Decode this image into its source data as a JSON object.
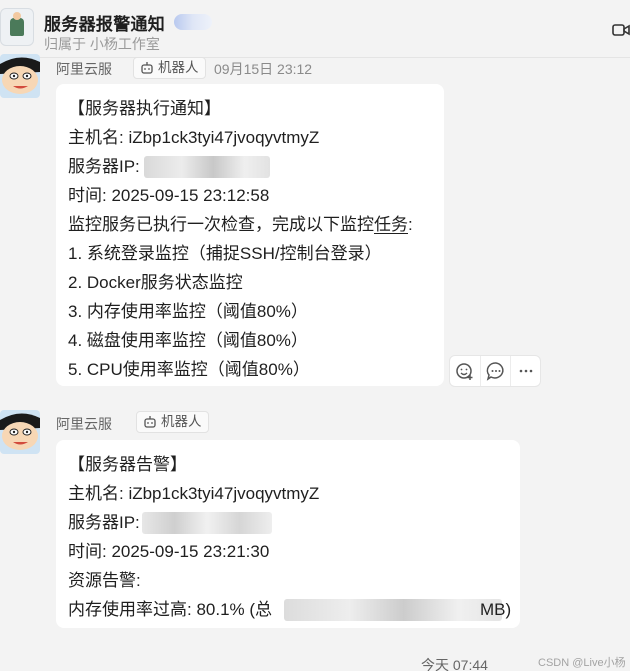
{
  "header": {
    "title": "服务器报警通知",
    "subtitle": "归属于 小杨工作室"
  },
  "messages": [
    {
      "sender": "阿里云服",
      "tag": "机器人",
      "time": "09月15日 23:12",
      "lines": [
        "【服务器执行通知】",
        "主机名: iZbp1ck3tyi47jvoqyvtmyZ",
        "服务器IP:",
        "时间: 2025-09-15 23:12:58",
        "监控服务已执行一次检查，完成以下监控",
        "任务",
        ":",
        "1. 系统登录监控（捕捉SSH/控制台登录）",
        "2. Docker服务状态监控",
        "3. 内存使用率监控（阈值80%）",
        "4. 磁盘使用率监控（阈值80%）",
        "5. CPU使用率监控（阈值80%）"
      ]
    },
    {
      "sender": "阿里云服",
      "tag": "机器人",
      "lines": [
        "【服务器告警】",
        "主机名: iZbp1ck3tyi47jvoqyvtmyZ",
        "服务器IP:",
        "时间: 2025-09-15 23:21:30",
        "资源告警:",
        "内存使用率过高: 80.1% (总",
        "MB)"
      ]
    }
  ],
  "footer": {
    "time": "今天 07:44",
    "watermark": "CSDN @Live小杨"
  },
  "icons": {
    "header_right": "video-call-icon",
    "robot": "robot-icon",
    "actions": [
      "add-emoji-icon",
      "comment-icon",
      "more-icon"
    ]
  }
}
